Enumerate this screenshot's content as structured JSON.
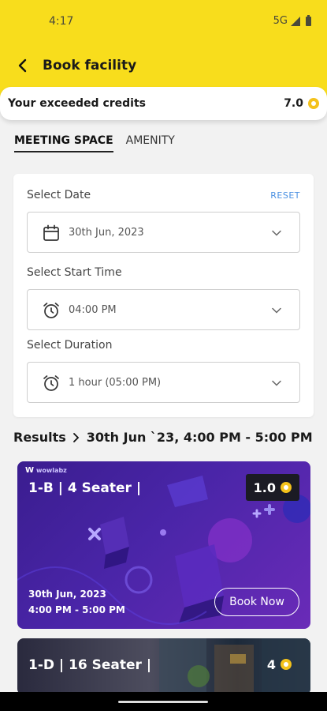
{
  "status_bar": {
    "time": "4:17",
    "network": "5G"
  },
  "header": {
    "title": "Book facility",
    "back_icon": "arrow-left-icon"
  },
  "credits": {
    "label": "Your exceeded credits",
    "value": "7.0",
    "icon": "coin-icon"
  },
  "tabs": [
    {
      "label": "MEETING SPACE",
      "active": true
    },
    {
      "label": "AMENITY",
      "active": false
    }
  ],
  "form": {
    "reset_label": "RESET",
    "date": {
      "label": "Select Date",
      "value": "30th Jun, 2023",
      "icon": "calendar-icon"
    },
    "start_time": {
      "label": "Select Start Time",
      "value": "04:00 PM",
      "icon": "alarm-clock-icon"
    },
    "duration": {
      "label": "Select Duration",
      "value": "1 hour (05:00 PM)",
      "icon": "alarm-clock-icon"
    }
  },
  "results": {
    "label": "Results",
    "summary": "30th Jun `23, 4:00 PM - 5:00 PM"
  },
  "rooms": [
    {
      "brand": "wowlabz",
      "title": "1-B | 4 Seater |",
      "credits": "1.0",
      "date": "30th Jun, 2023",
      "time": "4:00 PM - 5:00 PM",
      "book_label": "Book Now"
    },
    {
      "title": "1-D | 16 Seater |",
      "credits": "4"
    }
  ],
  "colors": {
    "brand_yellow": "#f8dd1c",
    "accent_blue": "#4a90e2",
    "card_purple": "#3a1d8f",
    "coin": "#f4c21b"
  }
}
